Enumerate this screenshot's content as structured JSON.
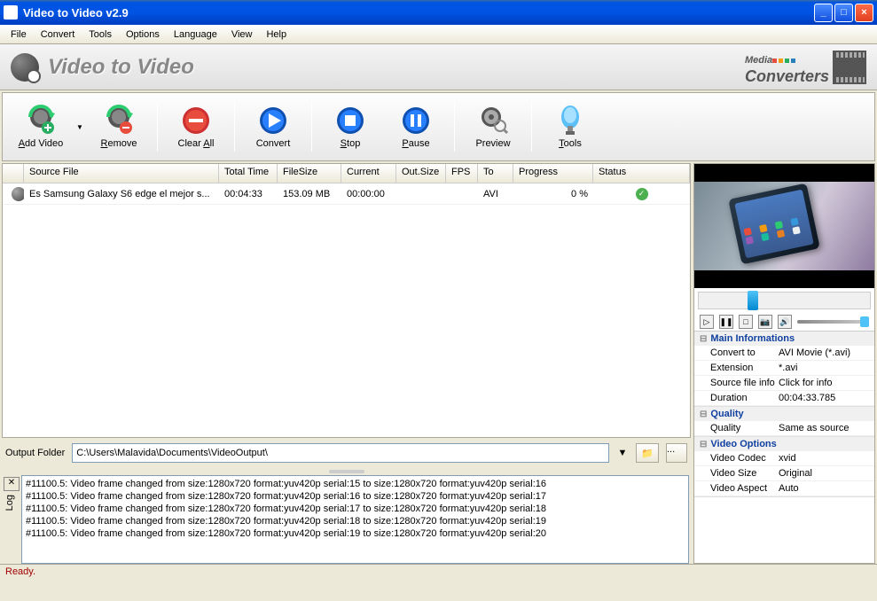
{
  "window": {
    "title": "Video to Video v2.9"
  },
  "menu": [
    "File",
    "Convert",
    "Tools",
    "Options",
    "Language",
    "View",
    "Help"
  ],
  "banner": {
    "title": "Video to Video",
    "brand1": "Media",
    "brand2": "Converters"
  },
  "toolbar": {
    "addVideo": "Add Video",
    "remove": "Remove",
    "clearAll": "Clear All",
    "convert": "Convert",
    "stop": "Stop",
    "pause": "Pause",
    "preview": "Preview",
    "tools": "Tools"
  },
  "columns": {
    "source": "Source File",
    "totalTime": "Total Time",
    "fileSize": "FileSize",
    "current": "Current",
    "outSize": "Out.Size",
    "fps": "FPS",
    "to": "To",
    "progress": "Progress",
    "status": "Status"
  },
  "rows": [
    {
      "source": "Es Samsung Galaxy S6 edge el mejor s...",
      "totalTime": "00:04:33",
      "fileSize": "153.09 MB",
      "current": "00:00:00",
      "outSize": "",
      "fps": "",
      "to": "AVI",
      "progress": "0 %",
      "status": "ok"
    }
  ],
  "output": {
    "label": "Output Folder",
    "path": "C:\\Users\\Malavida\\Documents\\VideoOutput\\"
  },
  "log": {
    "label": "Log",
    "lines": [
      "#11100.5: Video frame changed from size:1280x720 format:yuv420p serial:15 to size:1280x720 format:yuv420p serial:16",
      "#11100.5: Video frame changed from size:1280x720 format:yuv420p serial:16 to size:1280x720 format:yuv420p serial:17",
      "#11100.5: Video frame changed from size:1280x720 format:yuv420p serial:17 to size:1280x720 format:yuv420p serial:18",
      "#11100.5: Video frame changed from size:1280x720 format:yuv420p serial:18 to size:1280x720 format:yuv420p serial:19",
      "#11100.5: Video frame changed from size:1280x720 format:yuv420p serial:19 to size:1280x720 format:yuv420p serial:20"
    ]
  },
  "status": "Ready.",
  "info": {
    "sections": [
      {
        "title": "Main Informations",
        "rows": [
          {
            "k": "Convert to",
            "v": "AVI Movie (*.avi)"
          },
          {
            "k": "Extension",
            "v": "*.avi"
          },
          {
            "k": "Source file info",
            "v": "Click for info"
          },
          {
            "k": "Duration",
            "v": "00:04:33.785"
          }
        ]
      },
      {
        "title": "Quality",
        "rows": [
          {
            "k": "Quality",
            "v": "Same as source"
          }
        ]
      },
      {
        "title": "Video Options",
        "rows": [
          {
            "k": "Video Codec",
            "v": "xvid"
          },
          {
            "k": "Video Size",
            "v": "Original"
          },
          {
            "k": "Video Aspect",
            "v": "Auto"
          }
        ]
      }
    ]
  }
}
